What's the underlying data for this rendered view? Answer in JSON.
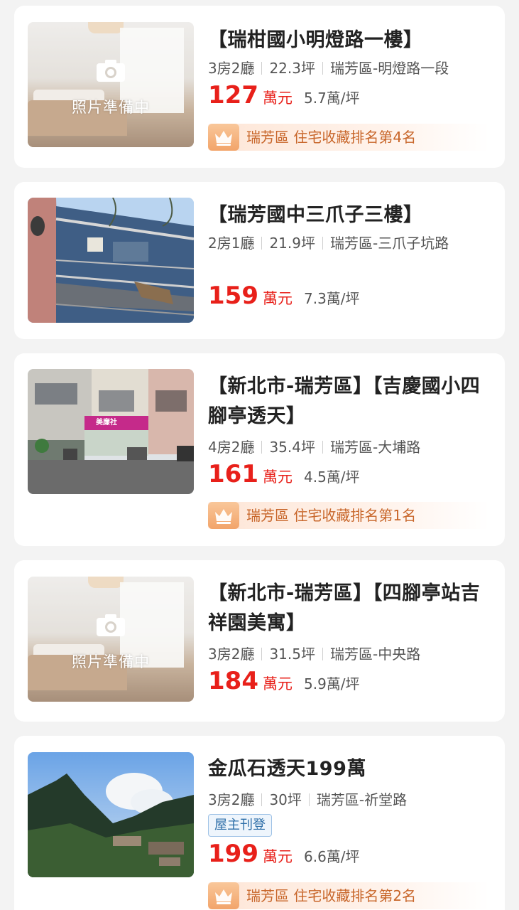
{
  "placeholder_label": "照片準備中",
  "listings": [
    {
      "title": "【瑞柑國小明燈路一樓】",
      "rooms": "3房2廳",
      "area": "22.3坪",
      "location": "瑞芳區-明燈路一段",
      "price": "127",
      "price_unit": "萬元",
      "price_per_ping": "5.7萬/坪",
      "rank_text": "瑞芳區 住宅收藏排名第4名"
    },
    {
      "title": "【瑞芳國中三爪子三樓】",
      "rooms": "2房1廳",
      "area": "21.9坪",
      "location": "瑞芳區-三爪子坑路",
      "price": "159",
      "price_unit": "萬元",
      "price_per_ping": "7.3萬/坪"
    },
    {
      "title": "【新北市-瑞芳區】【吉慶國小四腳亭透天】",
      "rooms": "4房2廳",
      "area": "35.4坪",
      "location": "瑞芳區-大埔路",
      "price": "161",
      "price_unit": "萬元",
      "price_per_ping": "4.5萬/坪",
      "rank_text": "瑞芳區 住宅收藏排名第1名",
      "shop_sign": "美廉社"
    },
    {
      "title": "【新北市-瑞芳區】【四腳亭站吉祥園美寓】",
      "rooms": "3房2廳",
      "area": "31.5坪",
      "location": "瑞芳區-中央路",
      "price": "184",
      "price_unit": "萬元",
      "price_per_ping": "5.9萬/坪"
    },
    {
      "title": "金瓜石透天199萬",
      "rooms": "3房2廳",
      "area": "30坪",
      "location": "瑞芳區-祈堂路",
      "owner_tag": "屋主刊登",
      "price": "199",
      "price_unit": "萬元",
      "price_per_ping": "6.6萬/坪",
      "rank_text": "瑞芳區 住宅收藏排名第2名"
    }
  ],
  "colors": {
    "price_red": "#e8201a",
    "rank_orange": "#c8662a",
    "owner_blue": "#2e6fa8"
  }
}
